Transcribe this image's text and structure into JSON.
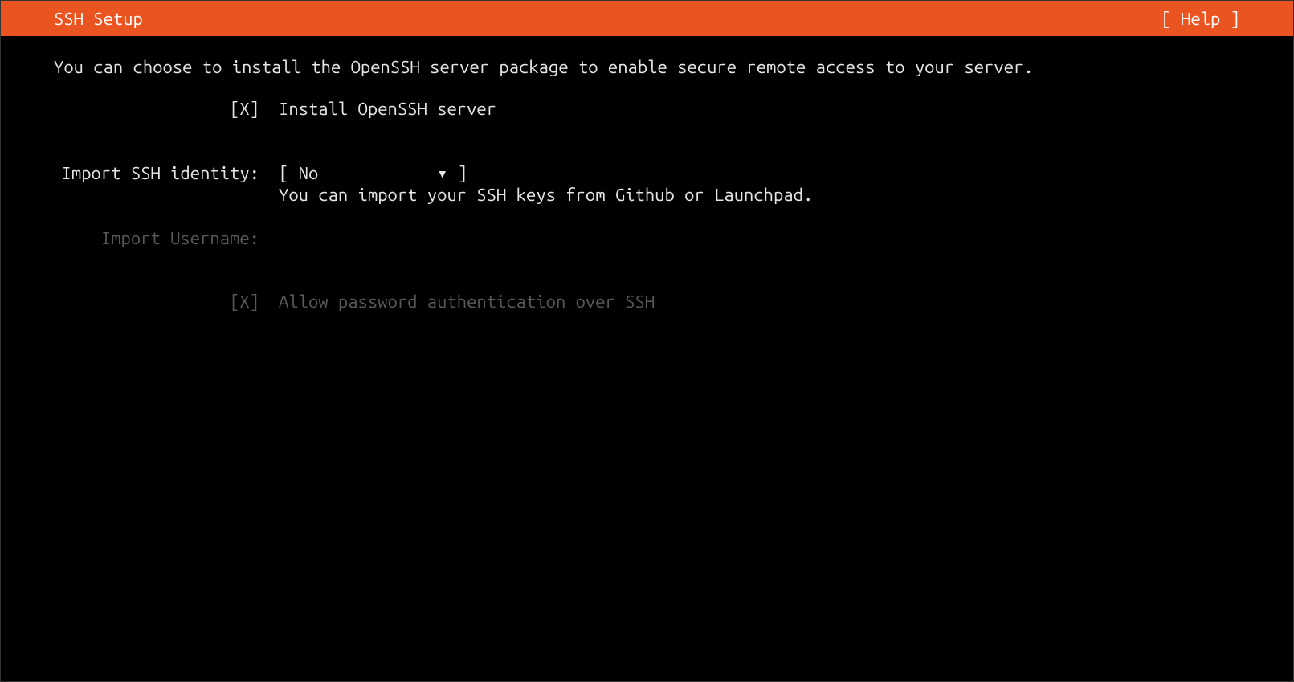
{
  "header": {
    "title": "SSH Setup",
    "help": "[ Help ]"
  },
  "intro": "You can choose to install the OpenSSH server package to enable secure remote access to your server.",
  "install": {
    "checkbox": "[X]",
    "label": "Install OpenSSH server"
  },
  "identity": {
    "label": "Import SSH identity:",
    "select_open": "[ ",
    "select_value": "No",
    "select_arrow": "▾",
    "select_close": " ]",
    "hint": "You can import your SSH keys from Github or Launchpad."
  },
  "username": {
    "label": "Import Username:"
  },
  "allow_pw": {
    "checkbox": "[X]",
    "label": "Allow password authentication over SSH"
  }
}
